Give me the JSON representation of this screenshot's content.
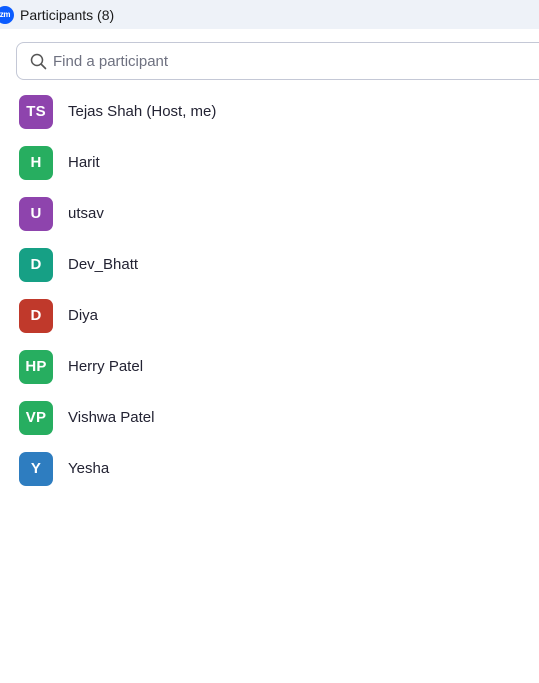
{
  "header": {
    "logo_text": "zm",
    "title": "Participants (8)"
  },
  "search": {
    "placeholder": "Find a participant",
    "value": ""
  },
  "participants": [
    {
      "initials": "TS",
      "name": "Tejas Shah (Host, me)",
      "color": "#8e44ad"
    },
    {
      "initials": "H",
      "name": "Harit",
      "color": "#27ae60"
    },
    {
      "initials": "U",
      "name": "utsav",
      "color": "#8e44ad"
    },
    {
      "initials": "D",
      "name": "Dev_Bhatt",
      "color": "#16a085"
    },
    {
      "initials": "D",
      "name": "Diya",
      "color": "#c0392b"
    },
    {
      "initials": "HP",
      "name": "Herry Patel",
      "color": "#27ae60"
    },
    {
      "initials": "VP",
      "name": "Vishwa Patel",
      "color": "#27ae60"
    },
    {
      "initials": "Y",
      "name": "Yesha",
      "color": "#2e7dc0"
    }
  ]
}
